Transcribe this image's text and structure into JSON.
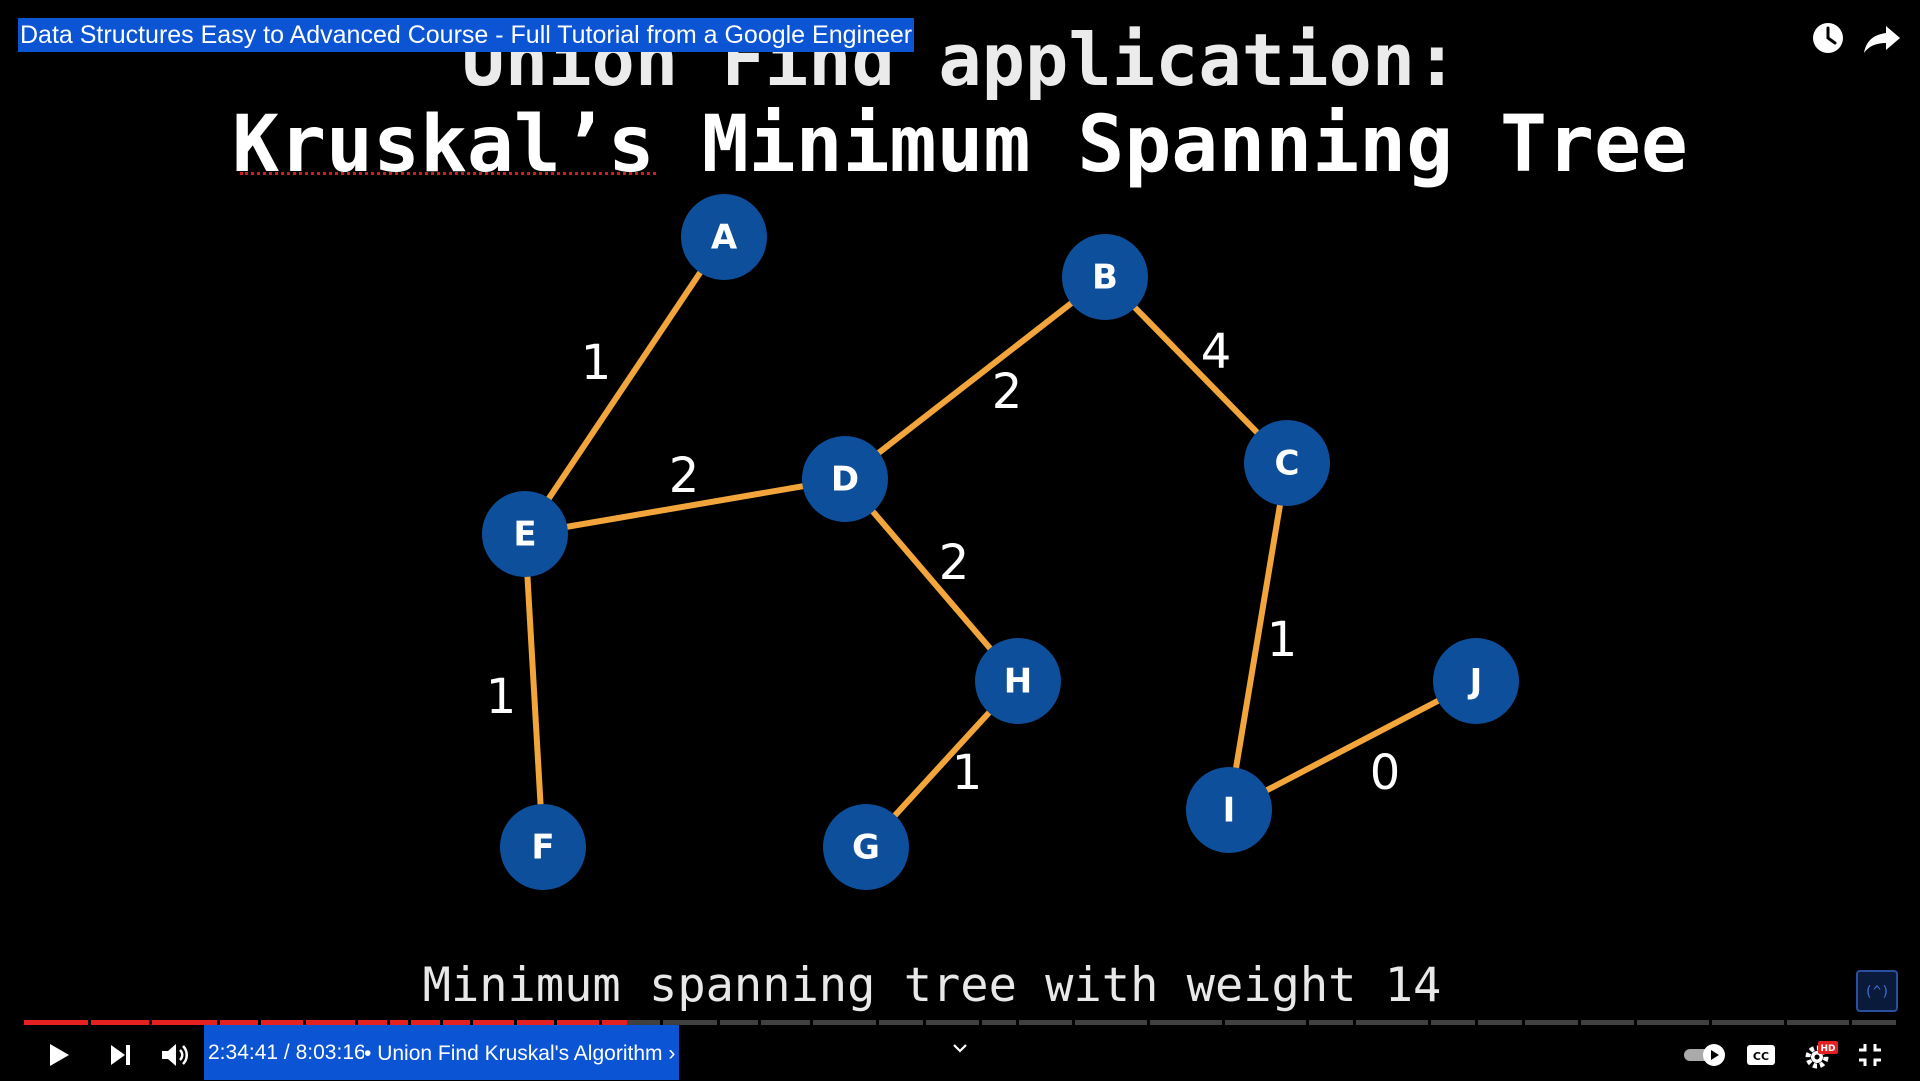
{
  "video_title": "Data Structures Easy to Advanced Course - Full Tutorial from a Google Engineer",
  "slide": {
    "title_line1": "Union Find application:",
    "title_line2": "Kruskal’s Minimum Spanning Tree",
    "caption": "Minimum spanning tree with weight 14"
  },
  "graph": {
    "nodes": [
      "A",
      "B",
      "C",
      "D",
      "E",
      "F",
      "G",
      "H",
      "I",
      "J"
    ],
    "edges": [
      {
        "from": "A",
        "to": "E",
        "weight": "1"
      },
      {
        "from": "E",
        "to": "F",
        "weight": "1"
      },
      {
        "from": "E",
        "to": "D",
        "weight": "2"
      },
      {
        "from": "D",
        "to": "B",
        "weight": "2"
      },
      {
        "from": "B",
        "to": "C",
        "weight": "4"
      },
      {
        "from": "D",
        "to": "H",
        "weight": "2"
      },
      {
        "from": "H",
        "to": "G",
        "weight": "1"
      },
      {
        "from": "C",
        "to": "I",
        "weight": "1"
      },
      {
        "from": "I",
        "to": "J",
        "weight": "0"
      }
    ],
    "colors": {
      "node": "#0d4f9a",
      "edge": "#f2a53a",
      "text": "#ffffff"
    }
  },
  "player": {
    "time_current": "2:34:41",
    "time_separator": "/",
    "time_total": "8:03:16",
    "chapter_bullet": "•",
    "chapter_title": "Union Find Kruskal's Algorithm",
    "chapter_chevron": "›",
    "progress_fraction": 0.322,
    "progress_color": "#e52020",
    "highlight_color": "#0b55d4",
    "hd_badge": "HD",
    "icons": {
      "watch_later": "clock-icon",
      "share": "share-arrow-icon",
      "play": "play-icon",
      "next": "skip-next-icon",
      "volume": "volume-icon",
      "expand": "chevron-down-icon",
      "autoplay": "autoplay-toggle-icon",
      "captions": "cc-icon",
      "settings": "gear-icon",
      "fullscreen": "exit-fullscreen-icon"
    }
  }
}
